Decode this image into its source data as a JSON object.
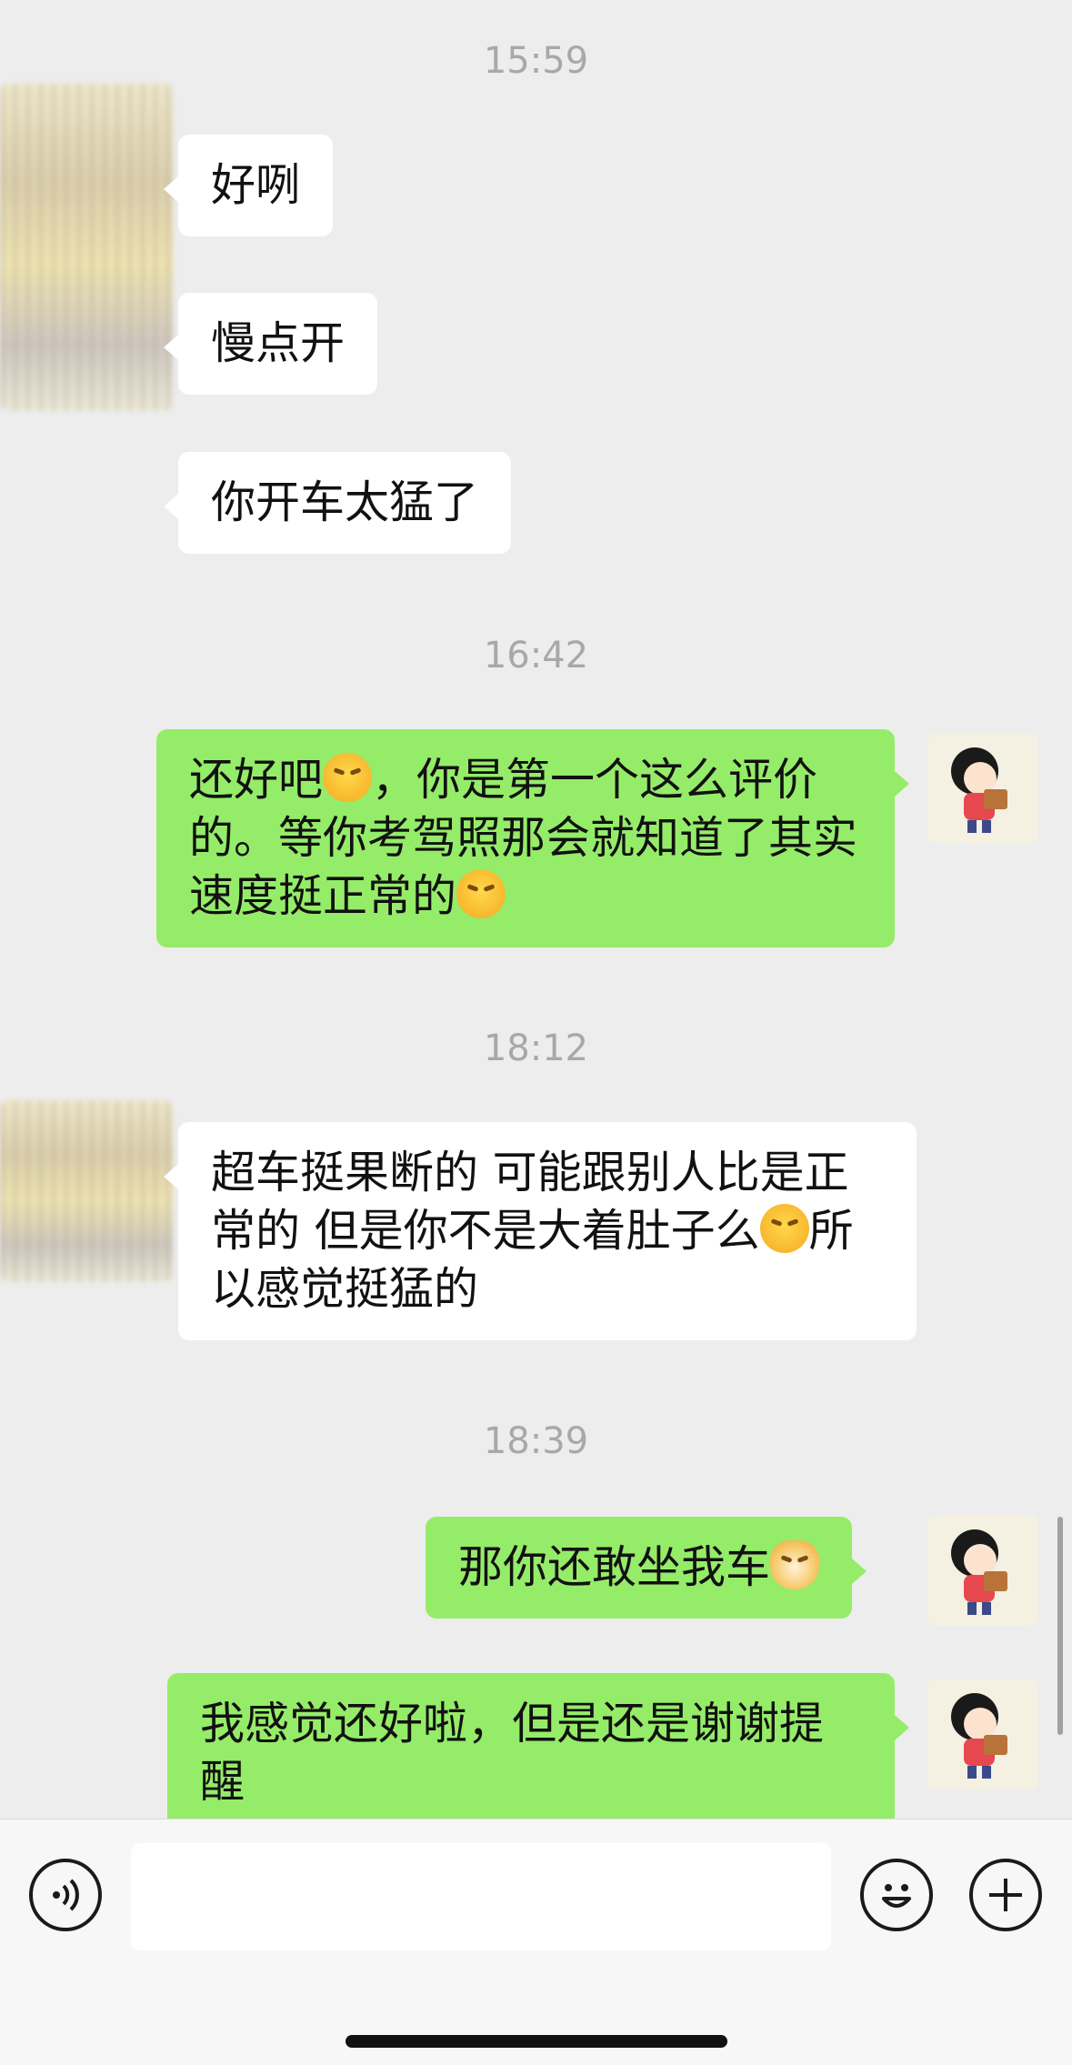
{
  "timestamps": [
    "15:59",
    "16:42",
    "18:12",
    "18:39"
  ],
  "messages": {
    "m1": "好咧",
    "m2": "慢点开",
    "m3": "你开车太猛了",
    "m4_a": "还好吧",
    "m4_b": "，你是第一个这么评价的。等你考驾照那会就知道了其实速度挺正常的",
    "m5_a": "超车挺果断的 可能跟别人比是正常的 但是你不是大着肚子么",
    "m5_b": "所以感觉挺猛的",
    "m6": "那你还敢坐我车",
    "m7": "我感觉还好啦，但是还是谢谢提醒"
  },
  "input": {
    "placeholder": ""
  },
  "colors": {
    "bubble_out": "#95ec69",
    "bubble_in": "#ffffff",
    "background": "#ededed"
  },
  "icons": [
    "voice-icon",
    "emoji-face-icon",
    "plus-icon",
    "laughing-crying-emoji",
    "cat-emoji"
  ]
}
